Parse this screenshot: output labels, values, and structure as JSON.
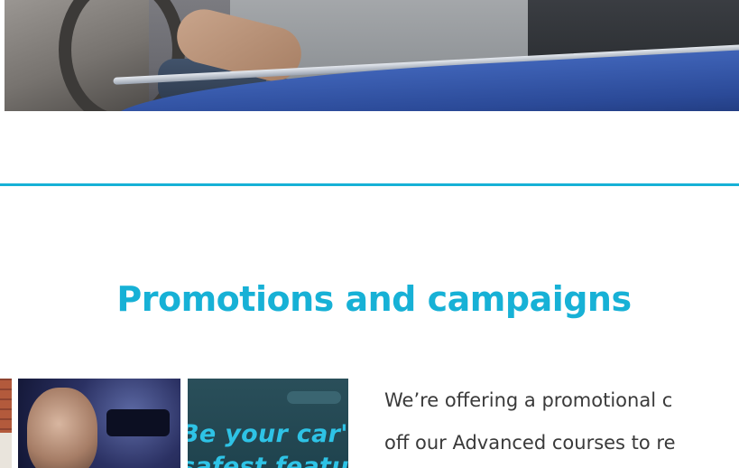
{
  "section": {
    "title": "Promotions and campaigns"
  },
  "promo": {
    "thumbnail_caption_line1": "Be your car's",
    "thumbnail_caption_line2": "safest featu",
    "body_line1": "We’re offering a promotional c",
    "body_line2": "off our Advanced courses to re"
  },
  "colors": {
    "accent": "#17b1d6",
    "text": "#3a3a3a"
  }
}
